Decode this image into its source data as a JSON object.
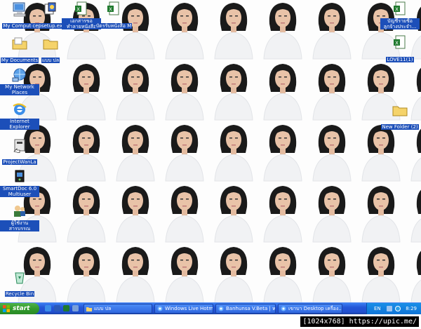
{
  "desktop": {
    "icons_left": [
      {
        "label": "My Computer",
        "icon": "my-computer-icon"
      },
      {
        "label": "cepsetup.exe1",
        "icon": "installer-icon"
      },
      {
        "label": "เอกสารขอ ทำลายหนังสือ",
        "icon": "excel-doc-icon"
      },
      {
        "label": "บัตรรับหนังสือ M",
        "icon": "excel-doc-icon"
      },
      {
        "label": "My Documents",
        "icon": "folder-icon"
      },
      {
        "label": "แบบ ปล",
        "icon": "folder-icon"
      },
      {
        "label": "My Network Places",
        "icon": "network-places-icon"
      },
      {
        "label": "Internet Explorer",
        "icon": "internet-explorer-icon"
      },
      {
        "label": "ProjectWanLa",
        "icon": "shortcut-icon"
      },
      {
        "label": "SmartDoc 6.0 Multiuser",
        "icon": "smartdoc-icon"
      },
      {
        "label": "ผู้ใช้งาน สารบรรณ",
        "icon": "users-icon"
      },
      {
        "label": "Recycle Bin",
        "icon": "recycle-bin-icon"
      }
    ],
    "icons_right": [
      {
        "label": "บัญชีรายชื่อ ลูกจ้างประจำ...",
        "icon": "excel-doc-icon"
      },
      {
        "label": "LOVE11(1)",
        "icon": "excel-doc-icon"
      },
      {
        "label": "New Folder (2)",
        "icon": "folder-icon"
      }
    ]
  },
  "taskbar": {
    "start_label": "start",
    "tasks": [
      {
        "label": "แบบ ปล",
        "icon": "folder-icon"
      },
      {
        "label": "Windows Live Hotmail...",
        "icon": "ie-icon"
      },
      {
        "label": "Banhunsa V.Beta | หน...",
        "icon": "ie-icon"
      },
      {
        "label": "เขาบา Desktop เครื่อง...",
        "icon": "ie-icon"
      }
    ],
    "tray": {
      "language": "EN",
      "clock": "8:29"
    }
  },
  "watermark": "[1024x768] https://upic.me/",
  "colors": {
    "taskbar": "#2355d6",
    "start": "#329a2d",
    "tray": "#0f74d6",
    "label_bg": "#1c4fb9"
  }
}
